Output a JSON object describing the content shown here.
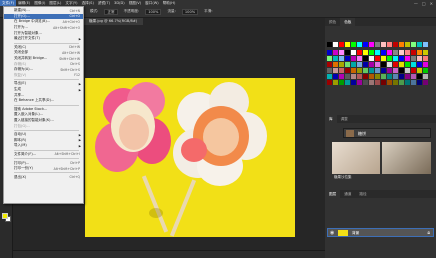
{
  "menubar": {
    "items": [
      "文件(F)",
      "编辑(E)",
      "图像(I)",
      "图层(L)",
      "文字(Y)",
      "选择(S)",
      "滤镜(T)",
      "3D(D)",
      "视图(V)",
      "窗口(W)",
      "帮助(H)"
    ],
    "window_controls": [
      "—",
      "□",
      "✕"
    ]
  },
  "optionsbar": {
    "mode_label": "模式:",
    "mode_value": "正常",
    "opacity_label": "不透明度:",
    "opacity_value": "100%",
    "flow_label": "流量:",
    "flow_value": "100%",
    "smooth_label": "平滑:"
  },
  "document": {
    "tab_title": "糖果.jpg @ 66.7%(RGB/8#)",
    "canvas_bg": "#f2e017"
  },
  "file_menu": {
    "items": [
      {
        "label": "新建(N)...",
        "shortcut": "Ctrl+N",
        "state": "normal"
      },
      {
        "label": "打开(O)...",
        "shortcut": "Ctrl+O",
        "state": "highlight"
      },
      {
        "label": "在 Bridge 中浏览(B)...",
        "shortcut": "Alt+Ctrl+O",
        "state": "normal"
      },
      {
        "label": "打开为...",
        "shortcut": "Alt+Shift+Ctrl+O",
        "state": "normal"
      },
      {
        "label": "打开为智能对象...",
        "shortcut": "",
        "state": "normal"
      },
      {
        "label": "最近打开文件(T)",
        "shortcut": "",
        "state": "submenu"
      },
      {
        "sep": true
      },
      {
        "label": "关闭(C)",
        "shortcut": "Ctrl+W",
        "state": "normal"
      },
      {
        "label": "关闭全部",
        "shortcut": "Alt+Ctrl+W",
        "state": "normal"
      },
      {
        "label": "关闭并转到 Bridge...",
        "shortcut": "Shift+Ctrl+W",
        "state": "normal"
      },
      {
        "label": "存储(S)",
        "shortcut": "Ctrl+S",
        "state": "disabled"
      },
      {
        "label": "存储为(A)...",
        "shortcut": "Shift+Ctrl+S",
        "state": "normal"
      },
      {
        "label": "恢复(V)",
        "shortcut": "F12",
        "state": "disabled"
      },
      {
        "sep": true
      },
      {
        "label": "导出(E)",
        "shortcut": "",
        "state": "submenu"
      },
      {
        "label": "生成",
        "shortcut": "",
        "state": "submenu"
      },
      {
        "label": "共享...",
        "shortcut": "",
        "state": "normal"
      },
      {
        "label": "在 Behance 上共享(D)...",
        "shortcut": "",
        "state": "normal"
      },
      {
        "sep": true
      },
      {
        "label": "搜索 Adobe Stock...",
        "shortcut": "",
        "state": "normal"
      },
      {
        "label": "置入嵌入对象(L)...",
        "shortcut": "",
        "state": "normal"
      },
      {
        "label": "置入链接的智能对象(K)...",
        "shortcut": "",
        "state": "normal"
      },
      {
        "label": "打包(G)...",
        "shortcut": "",
        "state": "disabled"
      },
      {
        "sep": true
      },
      {
        "label": "自动(U)",
        "shortcut": "",
        "state": "submenu"
      },
      {
        "label": "脚本(R)",
        "shortcut": "",
        "state": "submenu"
      },
      {
        "label": "导入(M)",
        "shortcut": "",
        "state": "submenu"
      },
      {
        "sep": true
      },
      {
        "label": "文件简介(F)...",
        "shortcut": "Alt+Shift+Ctrl+I",
        "state": "normal"
      },
      {
        "sep": true
      },
      {
        "label": "打印(P)...",
        "shortcut": "Ctrl+P",
        "state": "normal"
      },
      {
        "label": "打印一份(Y)",
        "shortcut": "Alt+Shift+Ctrl+P",
        "state": "normal"
      },
      {
        "sep": true
      },
      {
        "label": "退出(X)",
        "shortcut": "Ctrl+Q",
        "state": "normal"
      }
    ]
  },
  "panels": {
    "color_tabs": [
      "颜色",
      "色板"
    ],
    "library_tabs": [
      "库",
      "调整"
    ],
    "library_name": "糖饼",
    "library_item_label": "糖果沙拉集",
    "layers_tabs": [
      "图层",
      "通道",
      "路径"
    ],
    "layer_name": "背景"
  },
  "swatch_colors": [
    "#000000",
    "#ffffff",
    "#ff0000",
    "#ffff00",
    "#00ff00",
    "#00ffff",
    "#0000ff",
    "#ff00ff",
    "#7f7f7f",
    "#ffbfbf",
    "#ff7f7f",
    "#bf0000",
    "#ff7f00",
    "#bfbf00",
    "#7fff7f",
    "#00bfbf",
    "#7fbfff",
    "#0000bf",
    "#bf00bf",
    "#ff7fff"
  ]
}
